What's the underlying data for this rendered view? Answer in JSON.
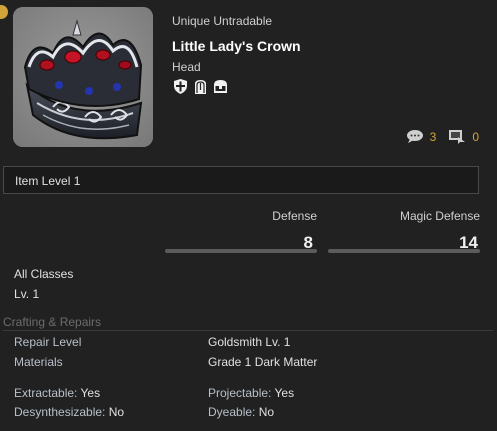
{
  "item": {
    "rarity": "Unique Untradable",
    "name": "Little Lady's Crown",
    "slot": "Head",
    "badges": [
      "shield-icon",
      "armoire-icon",
      "glamour-chest-icon"
    ]
  },
  "counts": {
    "comments": "3",
    "reposts": "0"
  },
  "item_level": "Item Level 1",
  "defense": {
    "defense_label": "Defense",
    "defense_value": "8",
    "magic_defense_label": "Magic Defense",
    "magic_defense_value": "14"
  },
  "requirements": {
    "classes": "All Classes",
    "level": "Lv. 1"
  },
  "crafting": {
    "header": "Crafting & Repairs",
    "repair_level_label": "Repair Level",
    "repair_level_value": "Goldsmith Lv. 1",
    "materials_label": "Materials",
    "materials_value": "Grade 1 Dark Matter",
    "extractable_label": "Extractable:",
    "extractable_value": "Yes",
    "projectable_label": "Projectable:",
    "projectable_value": "Yes",
    "desynth_label": "Desynthesizable:",
    "desynth_value": "No",
    "dyeable_label": "Dyeable:",
    "dyeable_value": "No"
  },
  "colors": {
    "background": "#212121",
    "accent_gold": "#d4a43a",
    "muted_header": "#6c6c6c"
  }
}
